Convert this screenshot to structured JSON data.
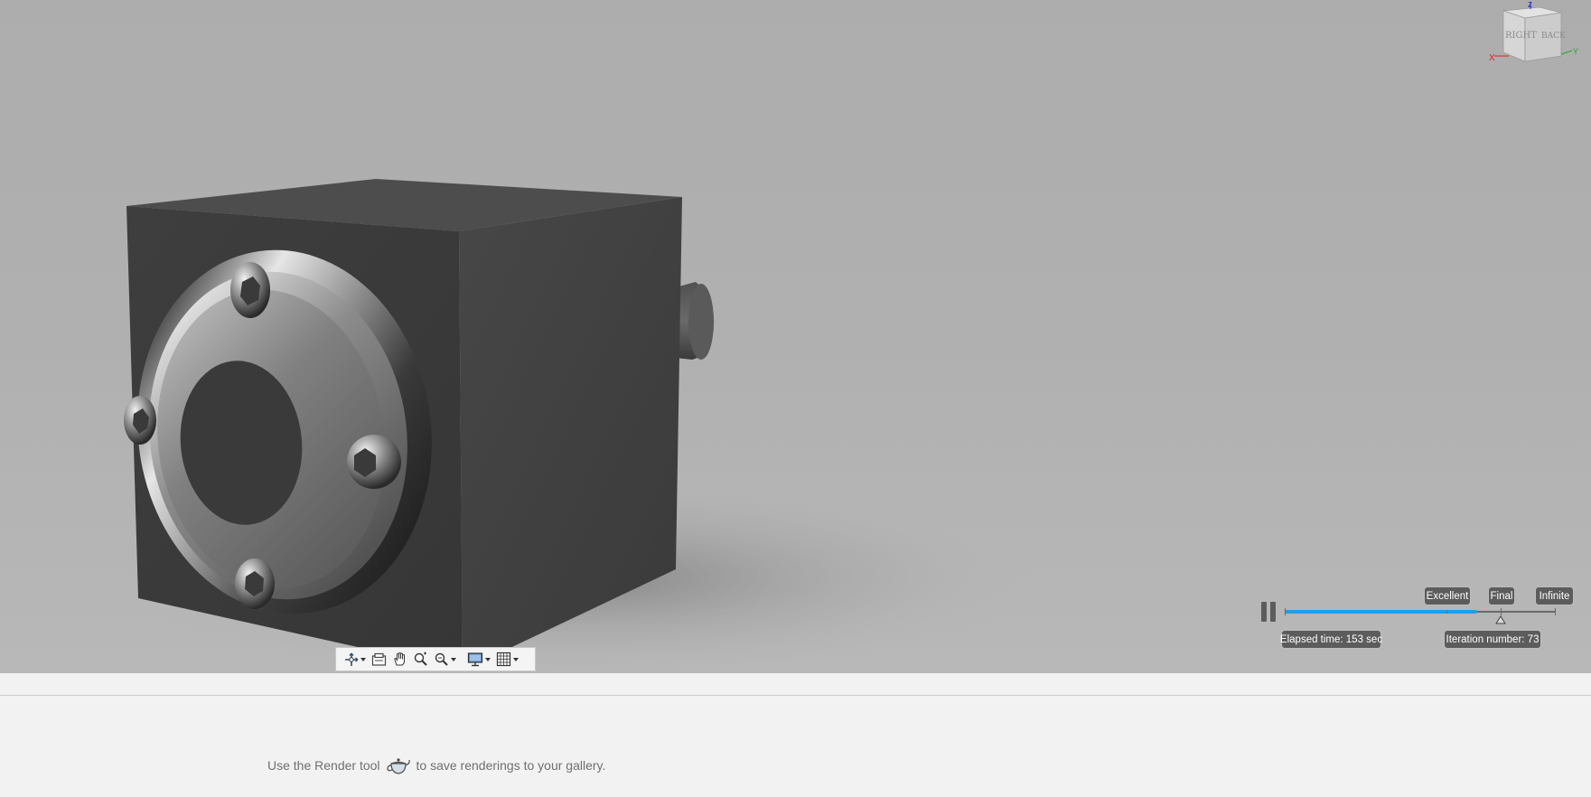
{
  "viewcube": {
    "face_right": "RIGHT",
    "face_back": "BACK",
    "axis_x": "X",
    "axis_y": "Y",
    "axis_z": "Z"
  },
  "toolbar": {
    "items": [
      {
        "name": "orbit",
        "icon": "orbit-icon",
        "has_dropdown": true
      },
      {
        "name": "look-at",
        "icon": "look-at-icon",
        "has_dropdown": false
      },
      {
        "name": "pan",
        "icon": "pan-hand-icon",
        "has_dropdown": false
      },
      {
        "name": "zoom",
        "icon": "zoom-icon",
        "has_dropdown": false
      },
      {
        "name": "fit",
        "icon": "zoom-window-icon",
        "has_dropdown": true
      },
      {
        "name": "display-settings",
        "icon": "display-monitor-icon",
        "has_dropdown": true
      },
      {
        "name": "grid-settings",
        "icon": "grid-icon",
        "has_dropdown": true
      }
    ]
  },
  "render_progress": {
    "quality_levels": [
      "Excellent",
      "Final",
      "Infinite"
    ],
    "elapsed_time": "Elapsed time: 153 sec",
    "iteration_number": "Iteration number: 73",
    "progress_fraction": 0.71,
    "fill_color": "#1ea0e6"
  },
  "gallery": {
    "hint_before": "Use the Render tool",
    "hint_after": "to save renderings to your gallery.",
    "render_tool_icon": "teapot-icon"
  }
}
